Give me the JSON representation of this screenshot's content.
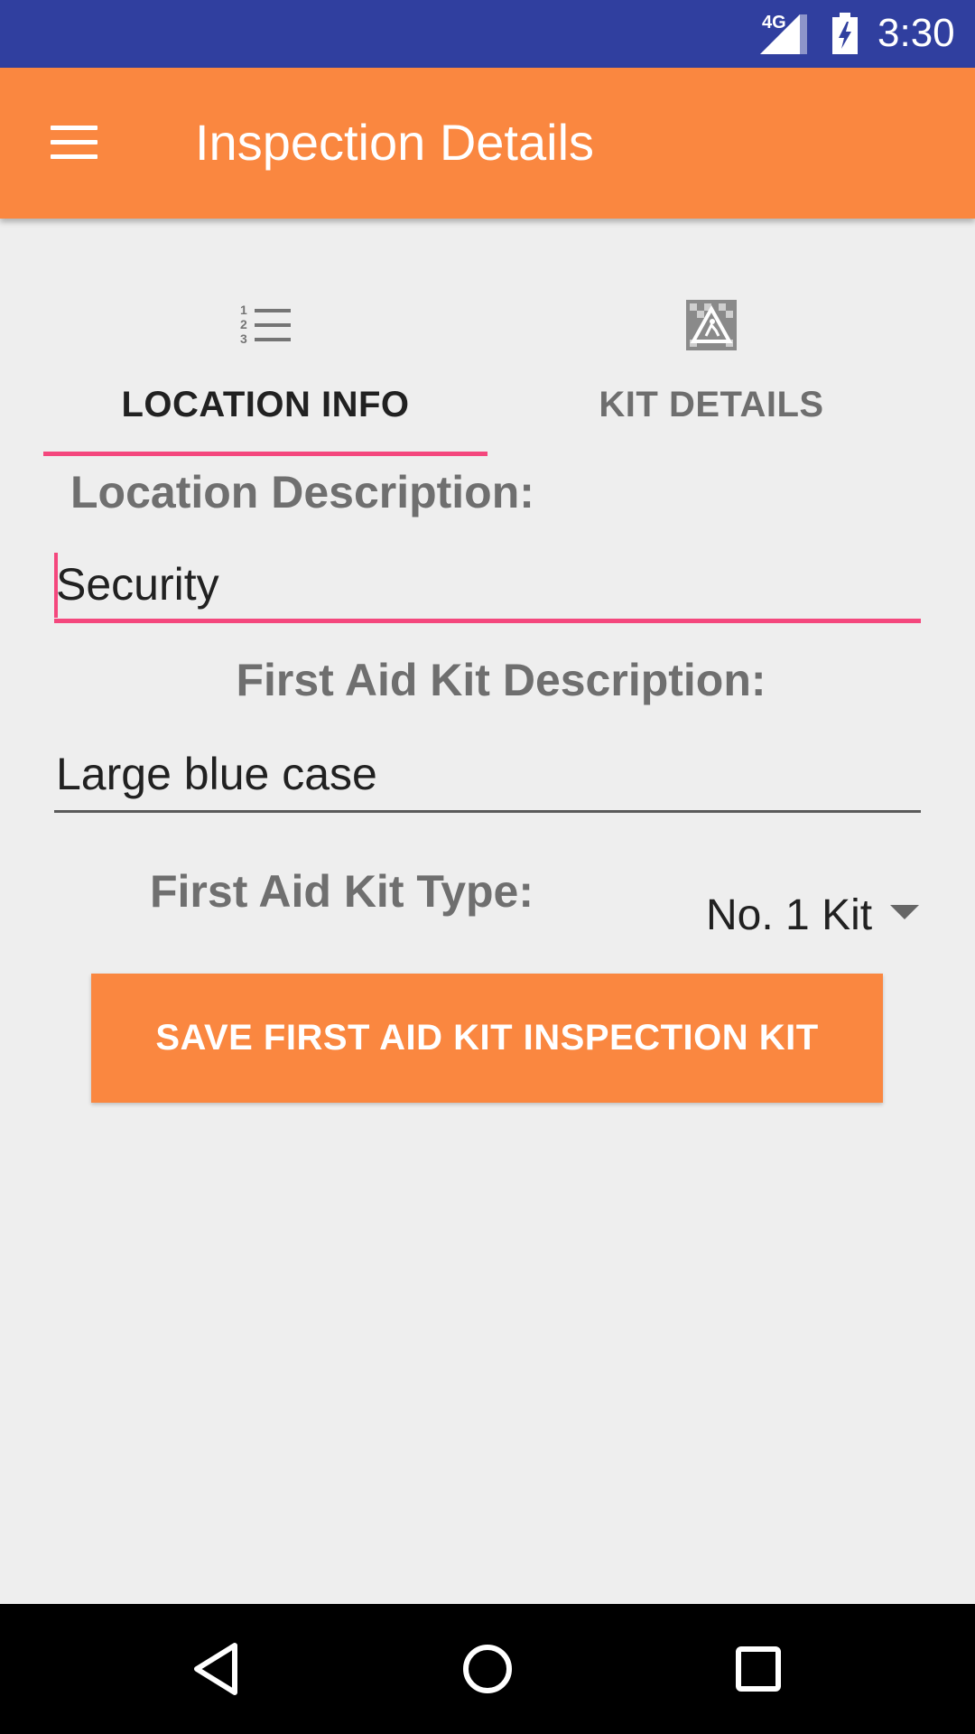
{
  "status_bar": {
    "network": "4G",
    "time": "3:30"
  },
  "app_bar": {
    "title": "Inspection Details",
    "menu_icon": "hamburger-menu-icon"
  },
  "tabs": [
    {
      "label": "LOCATION INFO",
      "icon": "numbered-list-icon",
      "selected": true
    },
    {
      "label": "KIT DETAILS",
      "icon": "first-aid-kit-icon",
      "selected": false
    }
  ],
  "form": {
    "location_label": "Location Description:",
    "location_value": "Security",
    "kit_desc_label": "First Aid Kit Description:",
    "kit_desc_value": "Large blue case",
    "kit_type_label": "First Aid Kit Type:",
    "kit_type_value": "No. 1 Kit"
  },
  "save_button": "SAVE FIRST AID KIT INSPECTION KIT",
  "colors": {
    "status_bar": "#303f9f",
    "app_bar": "#fa8740",
    "accent": "#f4477d",
    "background": "#eeeeee"
  },
  "nav_bar": {
    "icons": [
      "back-icon",
      "home-icon",
      "recents-icon"
    ]
  }
}
